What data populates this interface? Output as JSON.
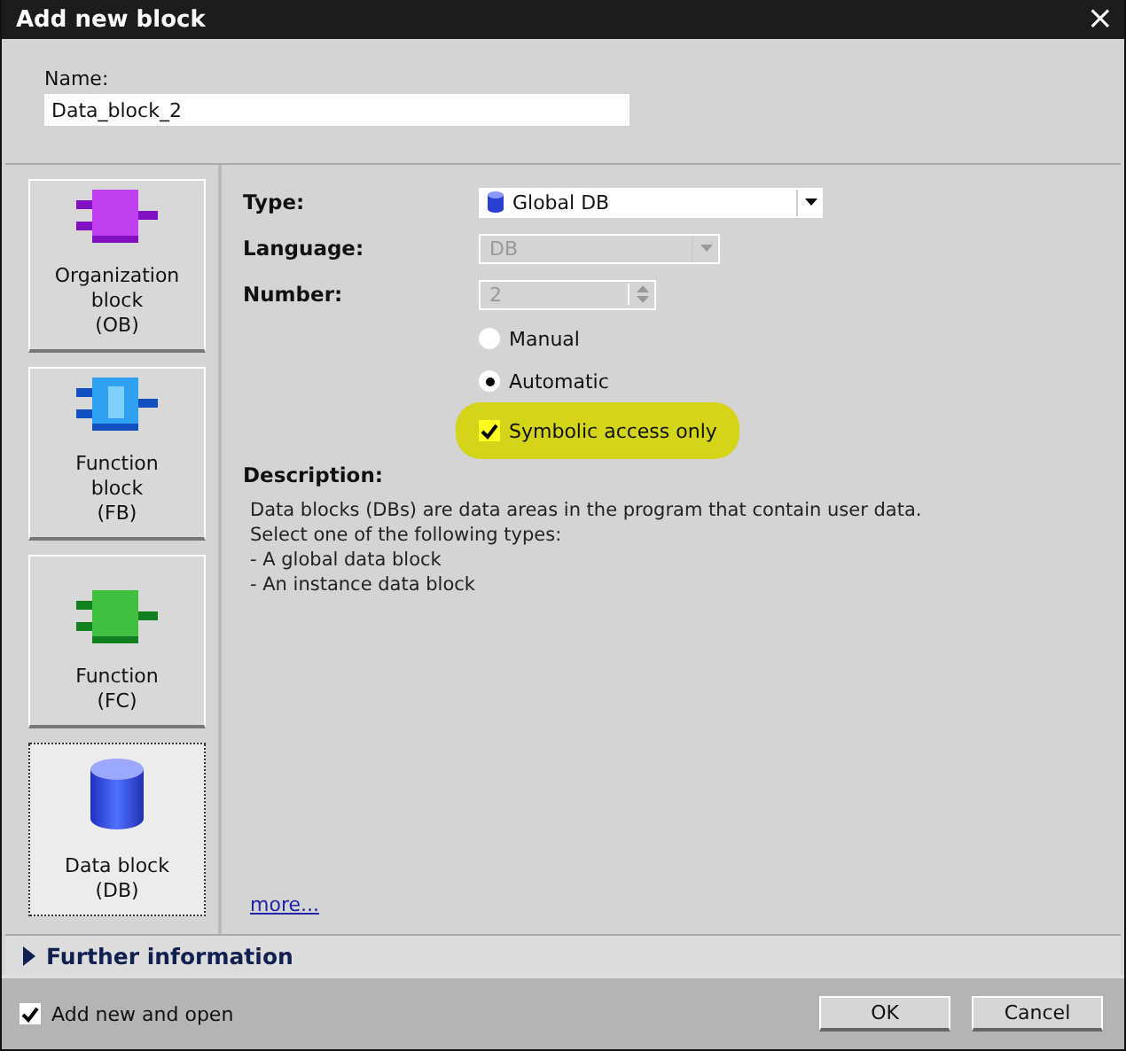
{
  "window": {
    "title": "Add new block",
    "close": "×"
  },
  "name_field": {
    "label": "Name:",
    "value": "Data_block_2"
  },
  "blocks": [
    {
      "kind": "ob",
      "label": "Organization\nblock\n(OB)",
      "selected": false
    },
    {
      "kind": "fb",
      "label": "Function\nblock\n(FB)",
      "selected": false
    },
    {
      "kind": "fc",
      "label": "Function\n(FC)",
      "selected": false
    },
    {
      "kind": "db",
      "label": "Data block\n(DB)",
      "selected": true
    }
  ],
  "type": {
    "label": "Type:",
    "value": "Global DB"
  },
  "language": {
    "label": "Language:",
    "value": "DB",
    "disabled": true
  },
  "number": {
    "label": "Number:",
    "value": "2",
    "disabled": true
  },
  "number_mode": [
    {
      "label": "Manual",
      "selected": false
    },
    {
      "label": "Automatic",
      "selected": true
    }
  ],
  "symbolic": {
    "label": "Symbolic access only",
    "checked": true,
    "highlighted": true
  },
  "description": {
    "label": "Description:",
    "lines": [
      "Data blocks (DBs) are data areas in the program that contain user data.",
      "Select one of the following types:",
      "- A global data block",
      "- An instance data block"
    ]
  },
  "more_link": "more...",
  "further_info": {
    "label": "Further information",
    "expanded": false
  },
  "add_open": {
    "label": "Add new and open",
    "checked": true
  },
  "buttons": [
    "OK",
    "Cancel"
  ]
}
